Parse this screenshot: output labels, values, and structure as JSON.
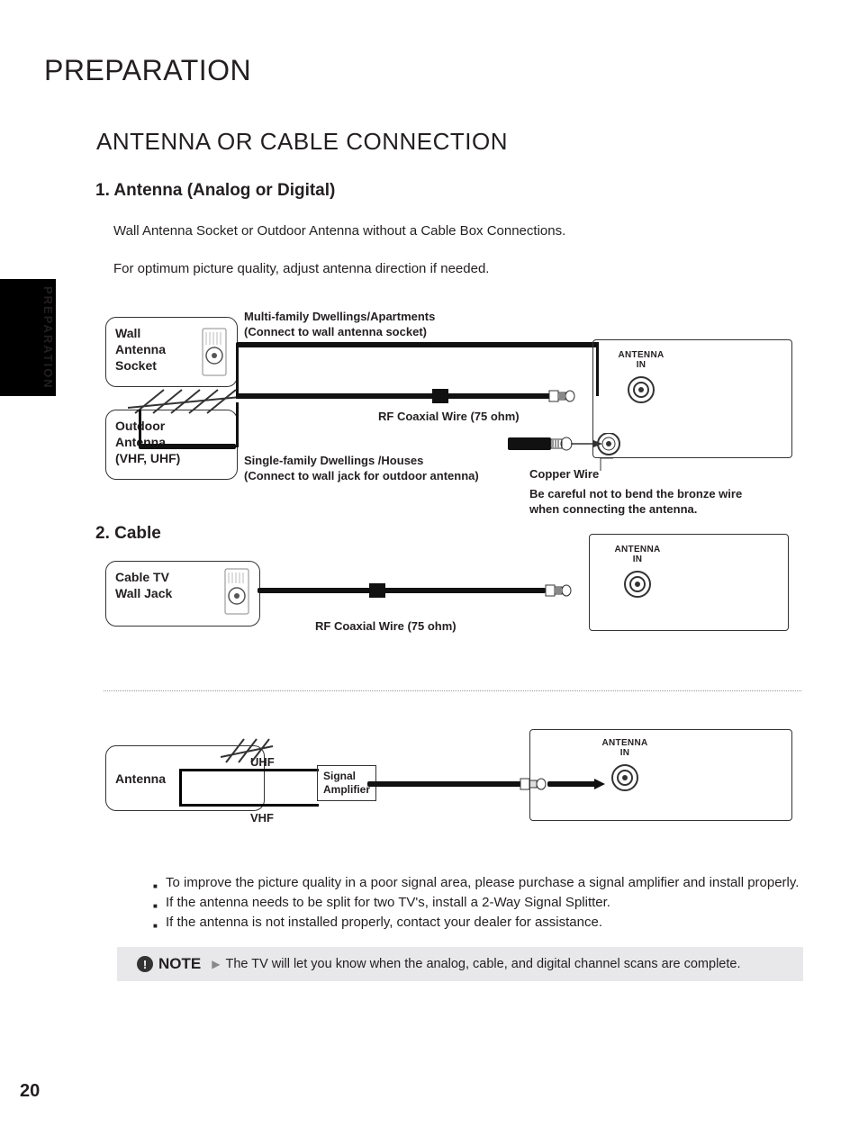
{
  "sideTab": "PREPARATION",
  "pageNumber": "20",
  "title": "PREPARATION",
  "sectionTitle": "ANTENNA OR CABLE CONNECTION",
  "s1": {
    "heading": "1. Antenna (Analog or Digital)",
    "p1": "Wall Antenna Socket or Outdoor Antenna without a Cable Box Connections.",
    "p2": "For optimum picture quality, adjust antenna direction if needed."
  },
  "d1": {
    "box1_l1": "Wall",
    "box1_l2": "Antenna",
    "box1_l3": "Socket",
    "box2_l1": "Outdoor",
    "box2_l2": "Antenna",
    "box2_l3": "(VHF, UHF)",
    "multi_l1": "Multi-family Dwellings/Apartments",
    "multi_l2": "(Connect to wall antenna socket)",
    "single_l1": "Single-family Dwellings /Houses",
    "single_l2": "(Connect to wall jack for outdoor antenna)",
    "rf": "RF Coaxial Wire (75 ohm)",
    "copper": "Copper Wire",
    "caution_l1": "Be careful not to bend the bronze wire",
    "caution_l2": "when connecting the antenna.",
    "port": "ANTENNA IN"
  },
  "s2": {
    "heading": "2. Cable"
  },
  "d2": {
    "box_l1": "Cable TV",
    "box_l2": "Wall Jack",
    "rf": "RF Coaxial Wire (75 ohm)",
    "port": "ANTENNA IN"
  },
  "d3": {
    "box": "Antenna",
    "uhf": "UHF",
    "vhf": "VHF",
    "amp_l1": "Signal",
    "amp_l2": "Amplifier",
    "port": "ANTENNA IN"
  },
  "bullets": {
    "b1": "To improve the picture quality in a poor signal area, please purchase a signal amplifier and install properly.",
    "b2": "If the antenna needs to be split for two TV's, install a 2-Way Signal Splitter.",
    "b3": "If the antenna is not installed properly, contact your dealer for assistance."
  },
  "note": {
    "label": "NOTE",
    "text": "The TV will let you know when the analog, cable, and digital channel scans are complete."
  }
}
